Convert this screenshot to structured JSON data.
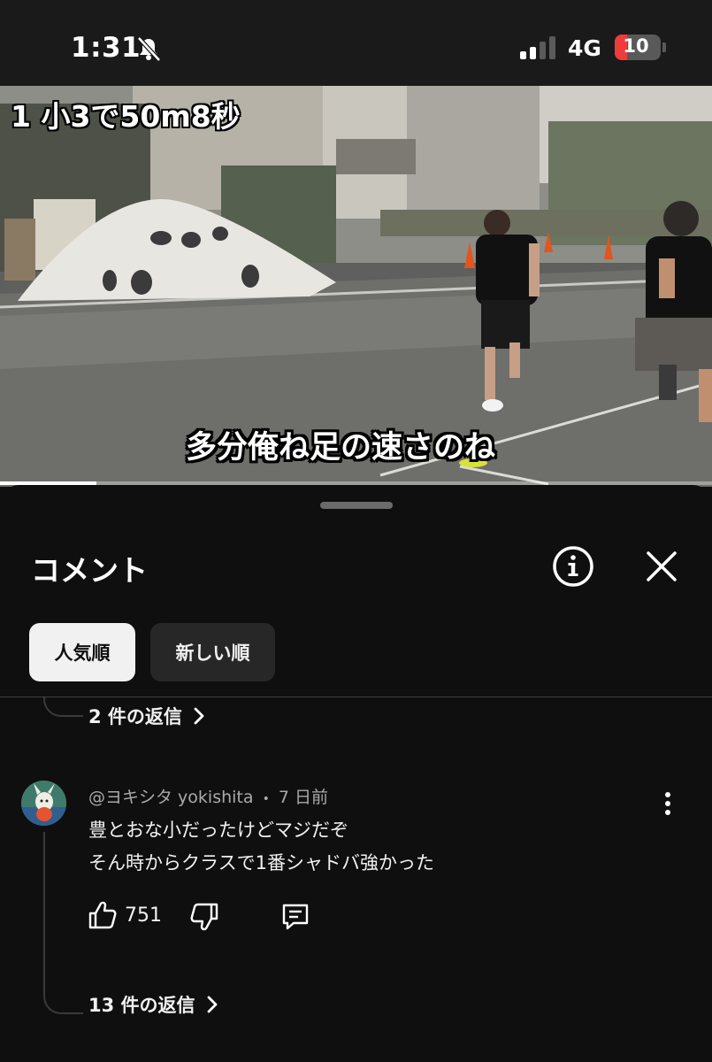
{
  "status_bar": {
    "time": "1:31",
    "network": "4G",
    "battery": "10",
    "icons": [
      "bell-slash-icon",
      "signal-icon",
      "battery-icon"
    ]
  },
  "video": {
    "caption_top": "1 小3で50m8秒",
    "caption_bottom": "多分俺ね足の速さのね",
    "progress_fraction": 0.135
  },
  "comments_panel": {
    "title": "コメント",
    "info_icon": "info-icon",
    "close_icon": "close-icon",
    "sort_chips": [
      {
        "label": "人気順",
        "selected": true
      },
      {
        "label": "新しい順",
        "selected": false
      }
    ],
    "previous_thread": {
      "replies_label": "2 件の返信"
    },
    "comment": {
      "author": "@ヨキシタ yokishita",
      "separator": "•",
      "time_ago": "7 日前",
      "lines": [
        "豊とおな小だったけどマジだぞ",
        "そん時からクラスで1番シャドバ強かった"
      ],
      "likes": "751",
      "replies_label": "13 件の返信"
    }
  },
  "colors": {
    "background": "#0f0f0f",
    "chip_active": "#f1f1f1",
    "chip_idle": "#272727",
    "secondary_text": "#aaaaaa",
    "battery_low": "#ef3b3b"
  }
}
